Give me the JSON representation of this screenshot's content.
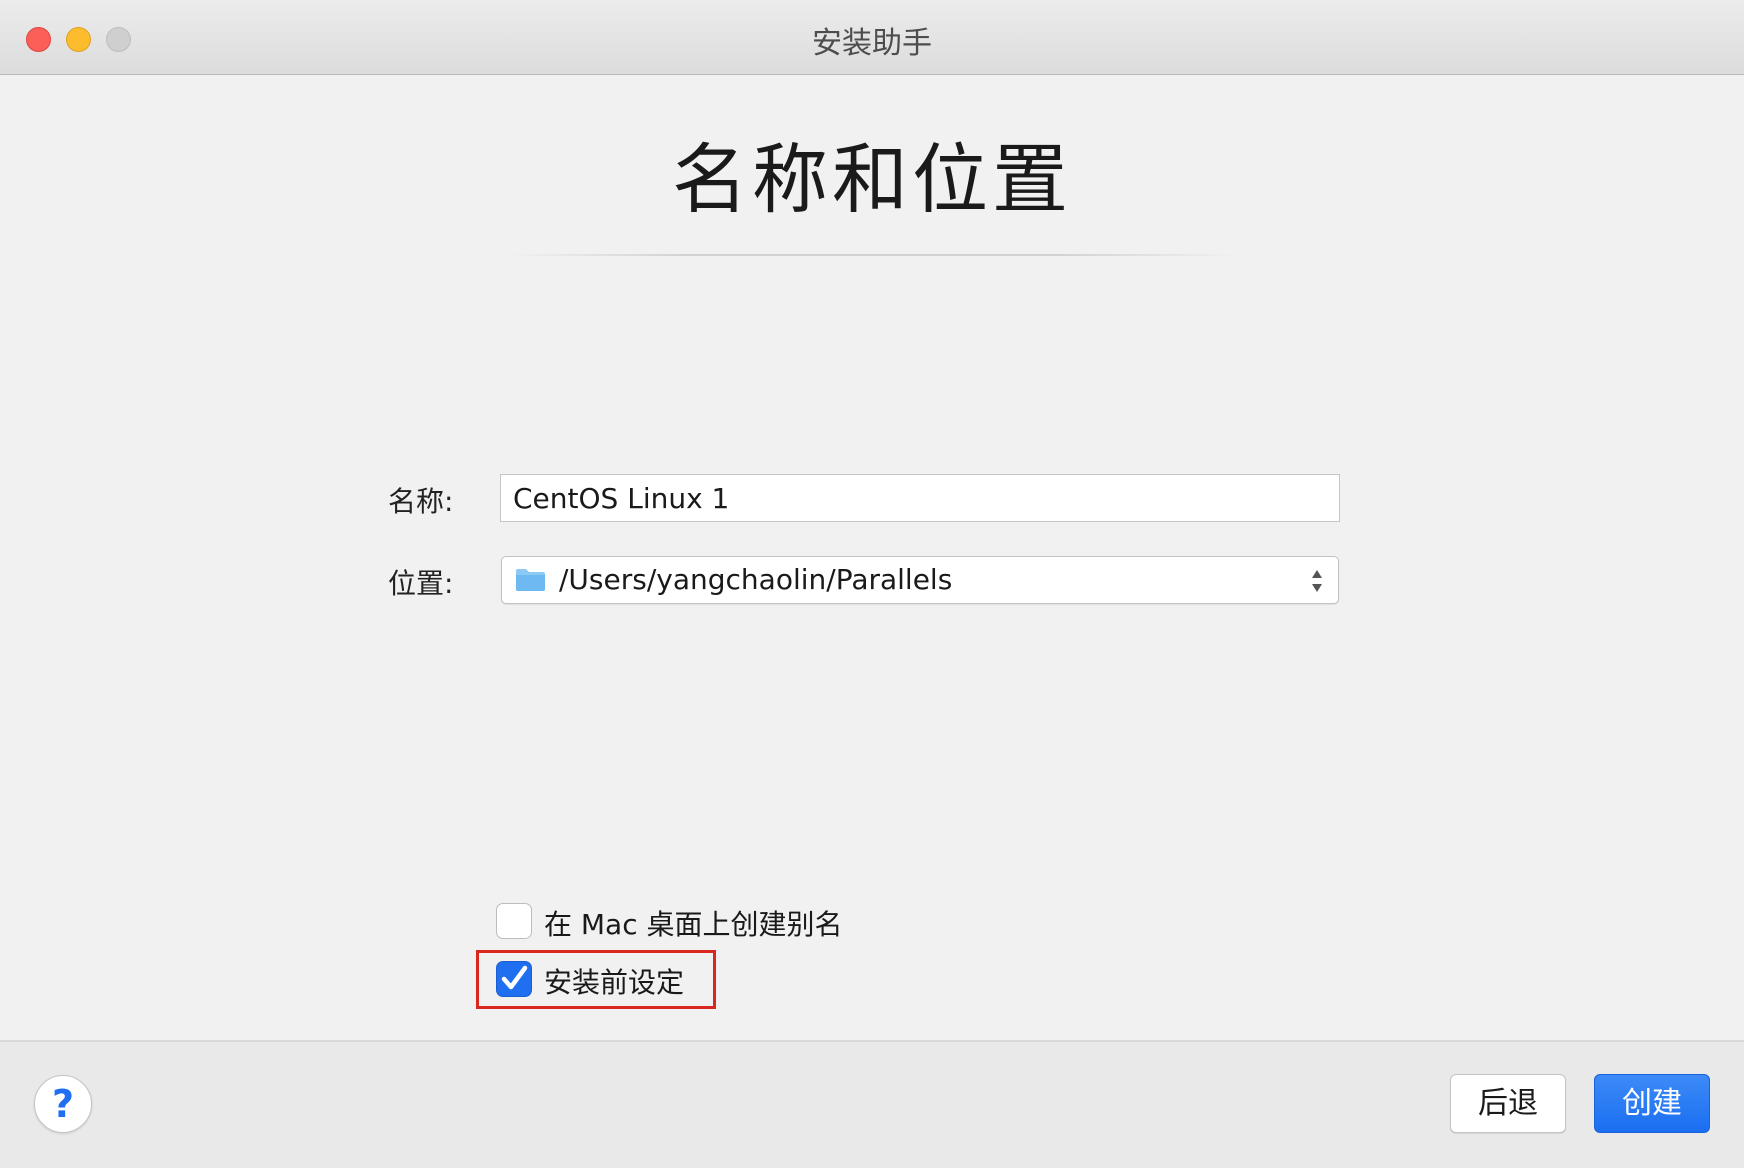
{
  "window": {
    "title": "安装助手"
  },
  "page": {
    "title": "名称和位置"
  },
  "form": {
    "name_label": "名称:",
    "name_value": "CentOS Linux 1",
    "location_label": "位置:",
    "location_value": "/Users/yangchaolin/Parallels"
  },
  "options": {
    "alias_label": "在 Mac 桌面上创建别名",
    "alias_checked": false,
    "presetup_label": "安装前设定",
    "presetup_checked": true
  },
  "footer": {
    "help_label": "?",
    "back_label": "后退",
    "create_label": "创建"
  },
  "colors": {
    "accent": "#1f6ff0",
    "highlight": "#d8281f",
    "close": "#fc5f57",
    "minimize": "#fdbc2e"
  },
  "icons": {
    "folder": "folder-icon",
    "stepper": "up-down-chevron-icon",
    "check": "checkmark-icon"
  }
}
